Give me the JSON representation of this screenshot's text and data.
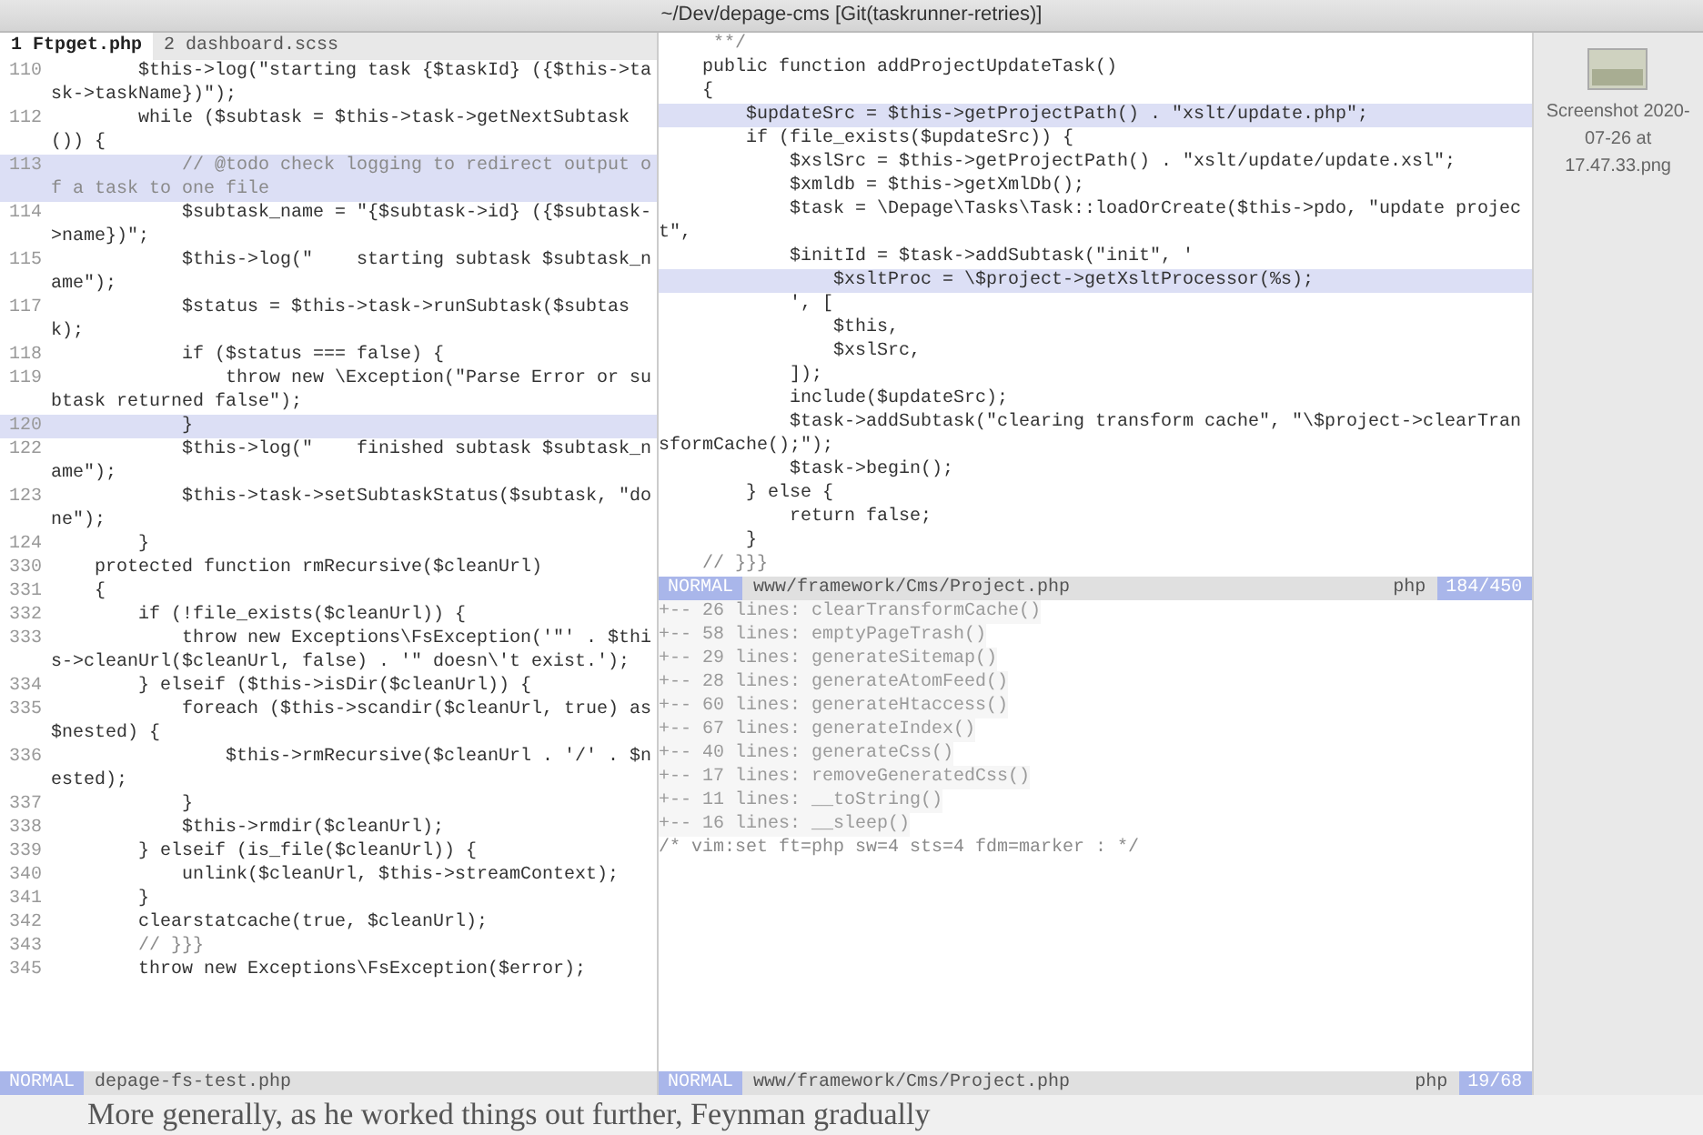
{
  "window": {
    "title": "~/Dev/depage-cms [Git(taskrunner-retries)]"
  },
  "tabs": [
    {
      "label": "1 Ftpget.php",
      "selected": true
    },
    {
      "label": "2 dashboard.scss",
      "selected": false
    }
  ],
  "left_pane": {
    "lines": [
      {
        "number": "110",
        "text": "        $this->log(\"starting task {$taskId} ({$this->task->taskName})\");",
        "kind": "code",
        "highlighted": false
      },
      {
        "number": "112",
        "text": "        while ($subtask = $this->task->getNextSubtask()) {",
        "kind": "code",
        "highlighted": false
      },
      {
        "number": "113",
        "text": "            // @todo check logging to redirect output of a task to one file",
        "kind": "comment",
        "highlighted": true
      },
      {
        "number": "114",
        "text": "            $subtask_name = \"{$subtask->id} ({$subtask->name})\";",
        "kind": "code",
        "highlighted": false
      },
      {
        "number": "115",
        "text": "            $this->log(\"    starting subtask $subtask_name\");",
        "kind": "code",
        "highlighted": false
      },
      {
        "number": "117",
        "text": "            $status = $this->task->runSubtask($subtask);",
        "kind": "code",
        "highlighted": false
      },
      {
        "number": "118",
        "text": "            if ($status === false) {",
        "kind": "code",
        "highlighted": false
      },
      {
        "number": "119",
        "text": "                throw new \\Exception(\"Parse Error or subtask returned false\");",
        "kind": "code",
        "highlighted": false
      },
      {
        "number": "120",
        "text": "            }",
        "kind": "code",
        "highlighted": true
      },
      {
        "number": "122",
        "text": "            $this->log(\"    finished subtask $subtask_name\");",
        "kind": "code",
        "highlighted": false
      },
      {
        "number": "123",
        "text": "            $this->task->setSubtaskStatus($subtask, \"done\");",
        "kind": "code",
        "highlighted": false
      },
      {
        "number": "124",
        "text": "        }",
        "kind": "code",
        "highlighted": false
      },
      {
        "number": "330",
        "text": "    protected function rmRecursive($cleanUrl)",
        "kind": "code",
        "highlighted": false
      },
      {
        "number": "331",
        "text": "    {",
        "kind": "code",
        "highlighted": false
      },
      {
        "number": "332",
        "text": "        if (!file_exists($cleanUrl)) {",
        "kind": "code",
        "highlighted": false
      },
      {
        "number": "333",
        "text": "            throw new Exceptions\\FsException('\"' . $this->cleanUrl($cleanUrl, false) . '\" doesn\\'t exist.');",
        "kind": "code",
        "highlighted": false
      },
      {
        "number": "334",
        "text": "        } elseif ($this->isDir($cleanUrl)) {",
        "kind": "code",
        "highlighted": false
      },
      {
        "number": "335",
        "text": "            foreach ($this->scandir($cleanUrl, true) as $nested) {",
        "kind": "code",
        "highlighted": false
      },
      {
        "number": "336",
        "text": "                $this->rmRecursive($cleanUrl . '/' . $nested);",
        "kind": "code",
        "highlighted": false
      },
      {
        "number": "337",
        "text": "            }",
        "kind": "code",
        "highlighted": false
      },
      {
        "number": "338",
        "text": "            $this->rmdir($cleanUrl);",
        "kind": "code",
        "highlighted": false
      },
      {
        "number": "339",
        "text": "        } elseif (is_file($cleanUrl)) {",
        "kind": "code",
        "highlighted": false
      },
      {
        "number": "340",
        "text": "            unlink($cleanUrl, $this->streamContext);",
        "kind": "code",
        "highlighted": false
      },
      {
        "number": "341",
        "text": "        }",
        "kind": "code",
        "highlighted": false
      },
      {
        "number": "342",
        "text": "        clearstatcache(true, $cleanUrl);",
        "kind": "code",
        "highlighted": false
      },
      {
        "number": "343",
        "text": "        // }}}",
        "kind": "comment",
        "highlighted": false
      },
      {
        "number": "345",
        "text": "        throw new Exceptions\\FsException($error);",
        "kind": "code",
        "highlighted": false
      }
    ],
    "status": {
      "mode": "NORMAL",
      "file": "depage-fs-test.php"
    }
  },
  "right_pane": {
    "top_lines": [
      {
        "text": "     **/",
        "kind": "comment",
        "highlighted": false
      },
      {
        "text": "    public function addProjectUpdateTask()",
        "kind": "code",
        "highlighted": false
      },
      {
        "text": "    {",
        "kind": "code",
        "highlighted": false
      },
      {
        "text": "        $updateSrc = $this->getProjectPath() . \"xslt/update.php\";",
        "kind": "code",
        "highlighted": true
      },
      {
        "text": "        if (file_exists($updateSrc)) {",
        "kind": "code",
        "highlighted": false
      },
      {
        "text": "            $xslSrc = $this->getProjectPath() . \"xslt/update/update.xsl\";",
        "kind": "code",
        "highlighted": false
      },
      {
        "text": "            $xmldb = $this->getXmlDb();",
        "kind": "code",
        "highlighted": false
      },
      {
        "text": "            $task = \\Depage\\Tasks\\Task::loadOrCreate($this->pdo, \"update project\",",
        "kind": "code",
        "highlighted": false
      },
      {
        "text": "            $initId = $task->addSubtask(\"init\", '",
        "kind": "code",
        "highlighted": false
      },
      {
        "text": "                $xsltProc = \\$project->getXsltProcessor(%s);",
        "kind": "code",
        "highlighted": true
      },
      {
        "text": "            ', [",
        "kind": "code",
        "highlighted": false
      },
      {
        "text": "                $this,",
        "kind": "code",
        "highlighted": false
      },
      {
        "text": "                $xslSrc,",
        "kind": "code",
        "highlighted": false
      },
      {
        "text": "            ]);",
        "kind": "code",
        "highlighted": false
      },
      {
        "text": "            include($updateSrc);",
        "kind": "code",
        "highlighted": false
      },
      {
        "text": "            $task->addSubtask(\"clearing transform cache\", \"\\$project->clearTransformCache();\");",
        "kind": "code",
        "highlighted": false
      },
      {
        "text": "            $task->begin();",
        "kind": "code",
        "highlighted": false
      },
      {
        "text": "        } else {",
        "kind": "code",
        "highlighted": false
      },
      {
        "text": "            return false;",
        "kind": "code",
        "highlighted": false
      },
      {
        "text": "        }",
        "kind": "code",
        "highlighted": false
      },
      {
        "text": "    // }}}",
        "kind": "comment",
        "highlighted": false
      }
    ],
    "status": {
      "mode": "NORMAL",
      "file": "www/framework/Cms/Project.php",
      "filetype": "php",
      "position": "184/450"
    },
    "bottom_lines": [
      {
        "text": "+-- 26 lines: clearTransformCache()",
        "kind": "fold",
        "highlighted": false
      },
      {
        "text": "+-- 58 lines: emptyPageTrash()",
        "kind": "fold",
        "highlighted": false
      },
      {
        "text": "+-- 29 lines: generateSitemap()",
        "kind": "fold",
        "highlighted": false
      },
      {
        "text": "+-- 28 lines: generateAtomFeed()",
        "kind": "fold",
        "highlighted": false
      },
      {
        "text": "+-- 60 lines: generateHtaccess()",
        "kind": "fold",
        "highlighted": false
      },
      {
        "text": "+-- 67 lines: generateIndex()",
        "kind": "fold",
        "highlighted": false
      },
      {
        "text": "+-- 40 lines: generateCss()",
        "kind": "fold",
        "highlighted": false
      },
      {
        "text": "+-- 17 lines: removeGeneratedCss()",
        "kind": "fold",
        "highlighted": false
      },
      {
        "text": "+-- 11 lines: __toString()",
        "kind": "fold",
        "highlighted": false
      },
      {
        "text": "+-- 16 lines: __sleep()",
        "kind": "fold",
        "highlighted": false
      },
      {
        "text": "/* vim:set ft=php sw=4 sts=4 fdm=marker : */",
        "kind": "comment",
        "highlighted": false
      }
    ]
  },
  "bottom_status": {
    "mode": "NORMAL",
    "file": "www/framework/Cms/Project.php",
    "filetype": "php",
    "position": "19/68"
  },
  "desktop_file": {
    "name": "Screenshot 2020-07-26 at 17.47.33.png"
  },
  "book_text": "More generally, as he worked things out further, Feynman gradually"
}
